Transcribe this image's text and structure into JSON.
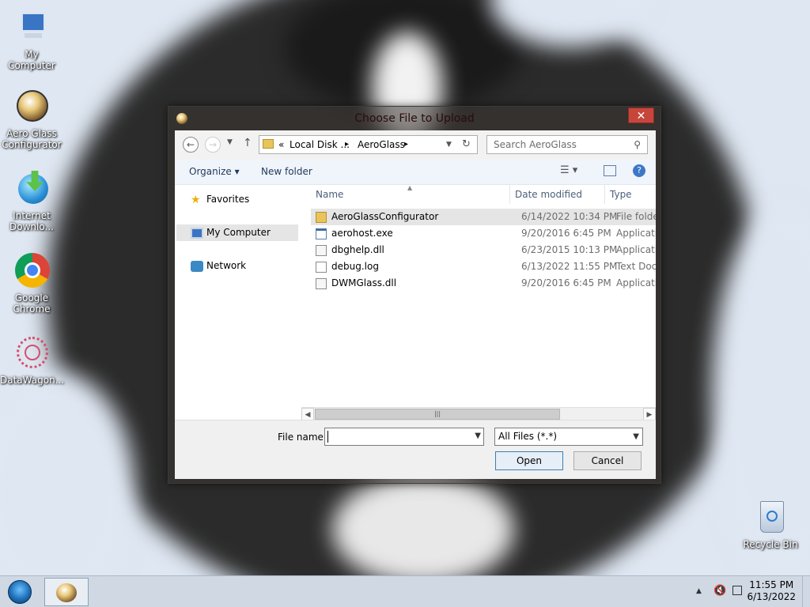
{
  "desktop": {
    "icons": [
      {
        "label": "My Computer",
        "icon": "computer-icon"
      },
      {
        "label": "Aero Glass Configurator",
        "icon": "aero-glass-icon"
      },
      {
        "label": "Internet Downlo...",
        "icon": "internet-download-icon"
      },
      {
        "label": "Google Chrome",
        "icon": "chrome-icon"
      },
      {
        "label": "DataWagon...",
        "icon": "datawagon-icon"
      },
      {
        "label": "Recycle Bin",
        "icon": "recycle-bin-icon"
      }
    ]
  },
  "dialog": {
    "title": "Choose File to Upload",
    "close_label": "✕",
    "address": {
      "prefix": "«",
      "crumbs": [
        "Local Disk ...",
        "AeroGlass"
      ],
      "sep": "▸"
    },
    "search_placeholder": "Search AeroGlass",
    "toolbar": {
      "organize": "Organize ▾",
      "new_folder": "New folder"
    },
    "nav": [
      {
        "label": "Favorites",
        "icon": "star-icon"
      },
      {
        "label": "My Computer",
        "icon": "computer-icon"
      },
      {
        "label": "Network",
        "icon": "network-icon"
      }
    ],
    "columns": [
      "Name",
      "Date modified",
      "Type"
    ],
    "files": [
      {
        "name": "AeroGlassConfigurator",
        "date": "6/14/2022 10:34 PM",
        "type": "File folder",
        "icon": "folder-icon"
      },
      {
        "name": "aerohost.exe",
        "date": "9/20/2016 6:45 PM",
        "type": "Application",
        "icon": "exe-icon"
      },
      {
        "name": "dbghelp.dll",
        "date": "6/23/2015 10:13 PM",
        "type": "Application extension",
        "icon": "dll-icon"
      },
      {
        "name": "debug.log",
        "date": "6/13/2022 11:55 PM",
        "type": "Text Document",
        "icon": "text-file-icon"
      },
      {
        "name": "DWMGlass.dll",
        "date": "9/20/2016 6:45 PM",
        "type": "Application extension",
        "icon": "dll-icon"
      }
    ],
    "file_name_label": "File name:",
    "file_name_value": "",
    "filter_value": "All Files (*.*)",
    "open_label": "Open",
    "cancel_label": "Cancel"
  },
  "taskbar": {
    "time": "11:55 PM",
    "date": "6/13/2022"
  }
}
